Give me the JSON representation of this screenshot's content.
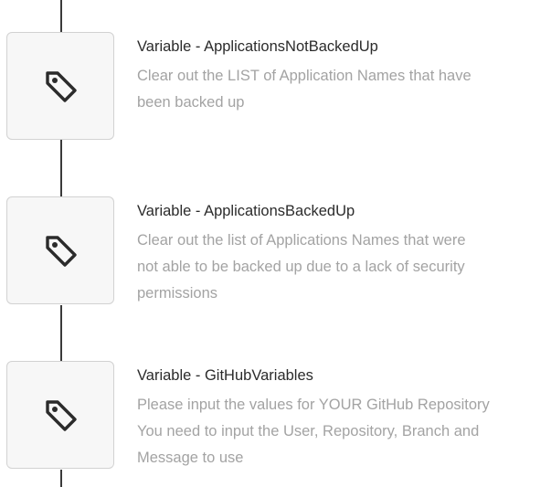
{
  "steps": [
    {
      "title": "Variable - ApplicationsNotBackedUp",
      "description_lines": [
        "Clear out the LIST of Application Names that have",
        "been backed up"
      ],
      "icon": "tag-icon"
    },
    {
      "title": "Variable - ApplicationsBackedUp",
      "description_lines": [
        "Clear out the list of Applications Names that were",
        "not able to be backed up due to a lack of security",
        "permissions"
      ],
      "icon": "tag-icon"
    },
    {
      "title": "Variable - GitHubVariables",
      "description_lines": [
        "Please input the values for YOUR GitHub Repository",
        "You need to input the User, Repository, Branch and",
        "Message to use"
      ],
      "icon": "tag-icon"
    }
  ],
  "colors": {
    "connector": "#3a3a3a",
    "box_border": "#d2d2d2",
    "box_fill": "#f7f7f7",
    "title_text": "#2b2b2b",
    "description_text": "#a3a3a3"
  }
}
